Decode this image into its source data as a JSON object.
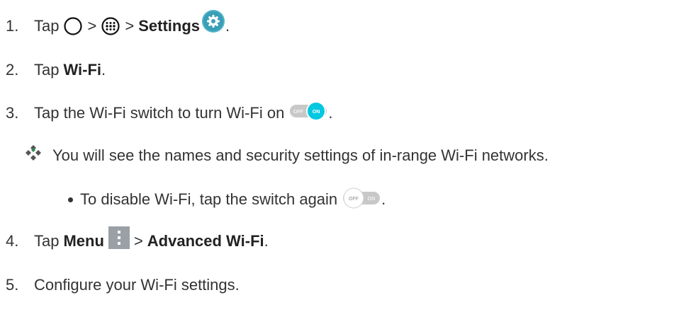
{
  "steps": [
    {
      "num": "1.",
      "tap": "Tap",
      "gt1": ">",
      "gt2": ">",
      "bold": "Settings",
      "end": "."
    },
    {
      "num": "2.",
      "tap": "Tap",
      "bold": "Wi-Fi",
      "end": "."
    },
    {
      "num": "3.",
      "text": "Tap the Wi-Fi switch to turn Wi-Fi on",
      "end": ".",
      "switch": {
        "off": "OFF",
        "on": "ON"
      }
    },
    {
      "num": "4.",
      "tap": "Tap",
      "bold1": "Menu",
      "gt": ">",
      "bold2": "Advanced Wi-Fi",
      "end": "."
    },
    {
      "num": "5.",
      "text": "Configure your Wi-Fi settings."
    }
  ],
  "note": {
    "text": "You will see the names and security settings of in-range Wi-Fi networks."
  },
  "bullet": {
    "text": "To disable Wi-Fi, tap the switch again",
    "end": ".",
    "switch": {
      "off": "OFF",
      "on": "ON"
    }
  },
  "colors": {
    "accent_on": "#00c8e0",
    "switch_track": "#c8c8c8",
    "menu_icon": "#9aa0a6",
    "settings_icon": "#4fb3c8"
  }
}
